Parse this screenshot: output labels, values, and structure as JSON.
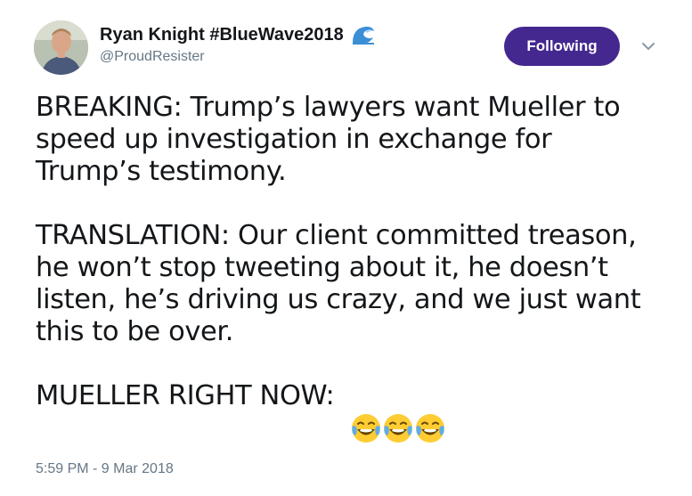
{
  "author": {
    "display_name": "Ryan Knight #BlueWave2018",
    "handle": "@ProudResister",
    "name_emoji": "water-wave-icon",
    "avatar": "avatar-photo"
  },
  "follow_button": {
    "label": "Following",
    "color": "#44288f"
  },
  "menu": {
    "icon": "chevron-down-icon"
  },
  "tweet": {
    "paragraph_1": "BREAKING: Trump’s lawyers want Mueller to\nspeed up investigation in exchange for\nTrump’s testimony.",
    "paragraph_2": "TRANSLATION: Our client committed treason,\nhe won’t stop tweeting about it, he doesn’t\nlisten, he’s driving us crazy, and we just want\nthis to be over.",
    "paragraph_3": "MUELLER RIGHT NOW:",
    "emojis": [
      "face-with-tears-of-joy-icon",
      "face-with-tears-of-joy-icon",
      "face-with-tears-of-joy-icon"
    ]
  },
  "timestamp": "5:59 PM - 9 Mar 2018",
  "colors": {
    "text": "#14171a",
    "secondary_text": "#657786",
    "wave_blue": "#3b8fd6",
    "emoji_yellow": "#ffcc33"
  }
}
